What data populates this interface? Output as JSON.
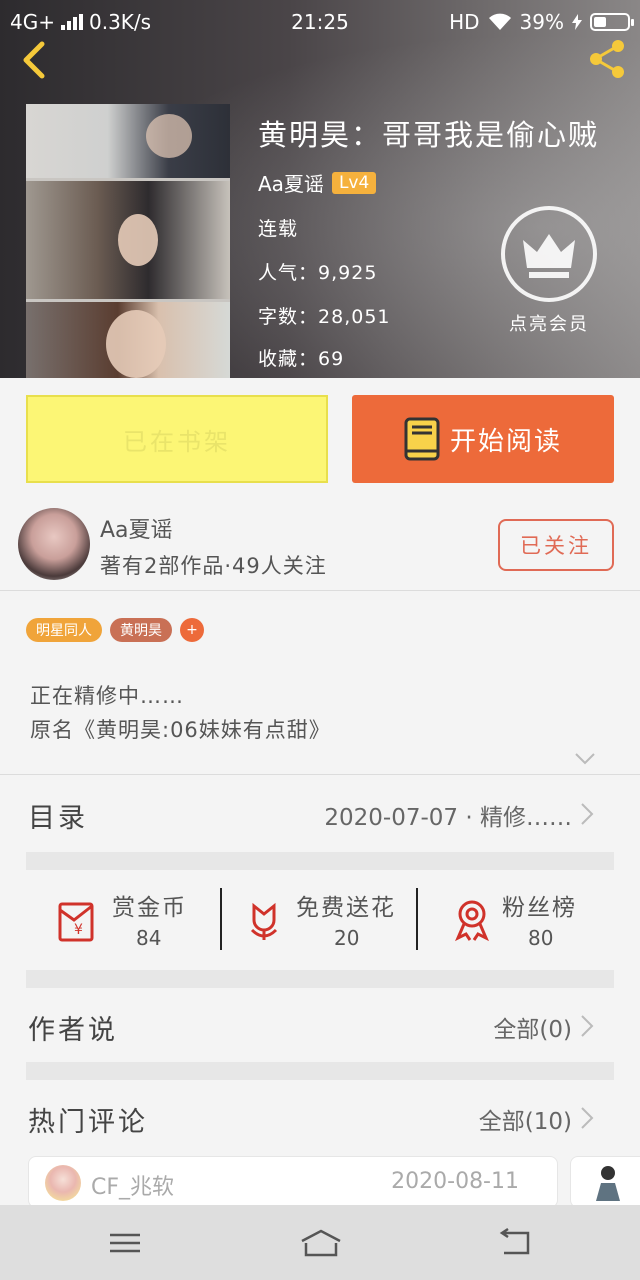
{
  "status_bar": {
    "network": "4G+",
    "speed": "0.3K/s",
    "time": "21:25",
    "hd": "HD",
    "battery": "39%"
  },
  "book": {
    "title": "黄明昊：哥哥我是偷心贼",
    "author": "Aa夏谣",
    "level": "Lv4",
    "status": "连载",
    "popularity_label": "人气：",
    "popularity": "9,925",
    "words_label": "字数：",
    "words": "28,051",
    "collect_label": "收藏：",
    "collect": "69",
    "vip_label": "点亮会员"
  },
  "actions": {
    "shelf": "已在书架",
    "read": "开始阅读"
  },
  "author_card": {
    "name": "Aa夏谣",
    "meta": "著有2部作品·49人关注",
    "follow": "已关注"
  },
  "tags": [
    {
      "label": "明星同人",
      "color": "#f0a43a"
    },
    {
      "label": "黄明昊",
      "color": "#c97055"
    },
    {
      "label": "+",
      "color": "#ed6a3a"
    }
  ],
  "description": {
    "line1": "正在精修中……",
    "line2": "原名《黄明昊:06妹妹有点甜》"
  },
  "catalog": {
    "label": "目录",
    "value": "2020-07-07 · 精修……"
  },
  "stats": [
    {
      "icon": "red-envelope-icon",
      "label": "赏金币",
      "value": "84"
    },
    {
      "icon": "flower-icon",
      "label": "免费送花",
      "value": "20"
    },
    {
      "icon": "medal-icon",
      "label": "粉丝榜",
      "value": "80"
    }
  ],
  "author_says": {
    "label": "作者说",
    "value": "全部(0)"
  },
  "hot_comments": {
    "label": "热门评论",
    "value": "全部(10)",
    "first": {
      "name": "CF_兆软",
      "date": "2020-08-11"
    }
  },
  "colors": {
    "accent": "#ed6a3a",
    "shelf_bg": "#fcf675",
    "level_badge": "#f5b13d",
    "icon_red": "#d0322a"
  }
}
